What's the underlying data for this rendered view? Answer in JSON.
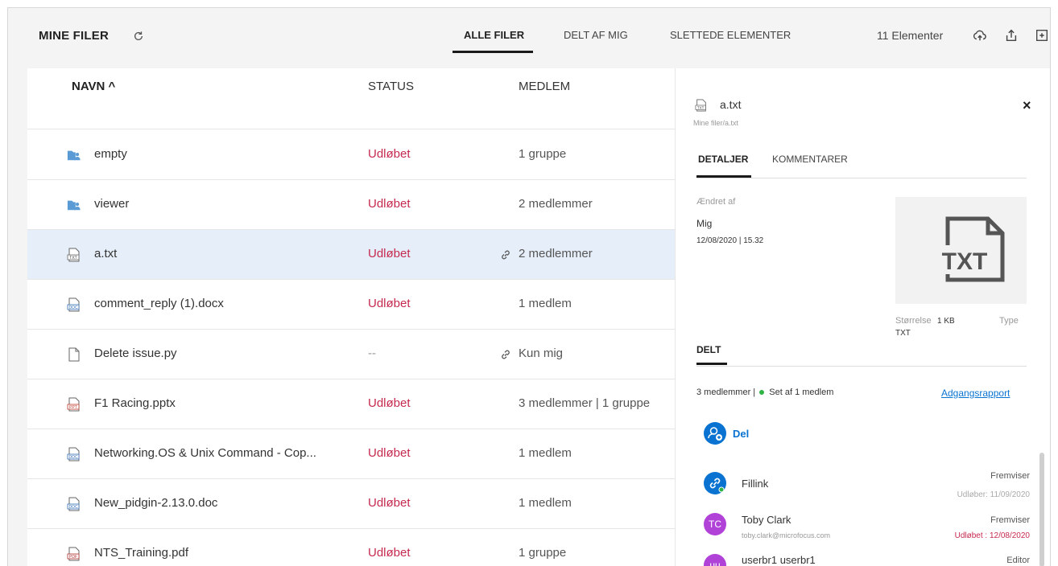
{
  "header": {
    "title": "MINE FILER",
    "tabs": [
      {
        "label": "ALLE FILER"
      },
      {
        "label": "DELT AF MIG"
      },
      {
        "label": "SLETTEDE ELEMENTER"
      }
    ],
    "count": "11 Elementer"
  },
  "columns": {
    "name": "NAVN ^",
    "status": "STATUS",
    "member": "MEDLEM"
  },
  "files": [
    {
      "name": "empty",
      "status": "Udløbet",
      "member": "1 gruppe"
    },
    {
      "name": "viewer",
      "status": "Udløbet",
      "member": "2 medlemmer"
    },
    {
      "name": "a.txt",
      "status": "Udløbet",
      "member": "2 medlemmer"
    },
    {
      "name": "comment_reply (1).docx",
      "status": "Udløbet",
      "member": "1 medlem"
    },
    {
      "name": "Delete issue.py",
      "status": "--",
      "member": "Kun mig"
    },
    {
      "name": "F1 Racing.pptx",
      "status": "Udløbet",
      "member": "3 medlemmer | 1 gruppe"
    },
    {
      "name": "Networking.OS & Unix Command - Cop...",
      "status": "Udløbet",
      "member": "1 medlem"
    },
    {
      "name": "New_pidgin-2.13.0.doc",
      "status": "Udløbet",
      "member": "1 medlem"
    },
    {
      "name": "NTS_Training.pdf",
      "status": "Udløbet",
      "member": "1 gruppe"
    }
  ],
  "details": {
    "file_name": "a.txt",
    "path": "Mine filer/a.txt",
    "close": "×",
    "tabs": [
      {
        "label": "DETALJER"
      },
      {
        "label": "KOMMENTARER"
      }
    ],
    "modified_by_label": "Ændret af",
    "modified_by": "Mig",
    "modified_date": "12/08/2020 | 15.32",
    "thumb_text": "TXT",
    "size_label": "Størrelse",
    "size_value": "1 KB",
    "type_label": "Type",
    "type_value": "TXT",
    "shared_heading": "DELT",
    "summary_members": "3 medlemmer |",
    "summary_seen": "Set af 1 medlem",
    "access_report": "Adgangsrapport",
    "share_label": "Del",
    "members": [
      {
        "name": "Fillink",
        "email": "",
        "role": "Fremviser",
        "expiry": "Udløber: 11/09/2020",
        "expired": false,
        "initials": ""
      },
      {
        "name": "Toby Clark",
        "email": "toby.clark@microfocus.com",
        "role": "Fremviser",
        "expiry": "Udløbet : 12/08/2020",
        "expired": true,
        "initials": "TC"
      },
      {
        "name": "userbr1 userbr1",
        "email": "",
        "role": "Editor",
        "expiry": "",
        "expired": false,
        "initials": "uu"
      }
    ]
  },
  "colors": {
    "accent": "#0a73d1",
    "expired": "#c6294f",
    "avatar_purple": "#b042d8",
    "folder_blue": "#5b9bd5",
    "selected_row": "#e5eef9"
  }
}
